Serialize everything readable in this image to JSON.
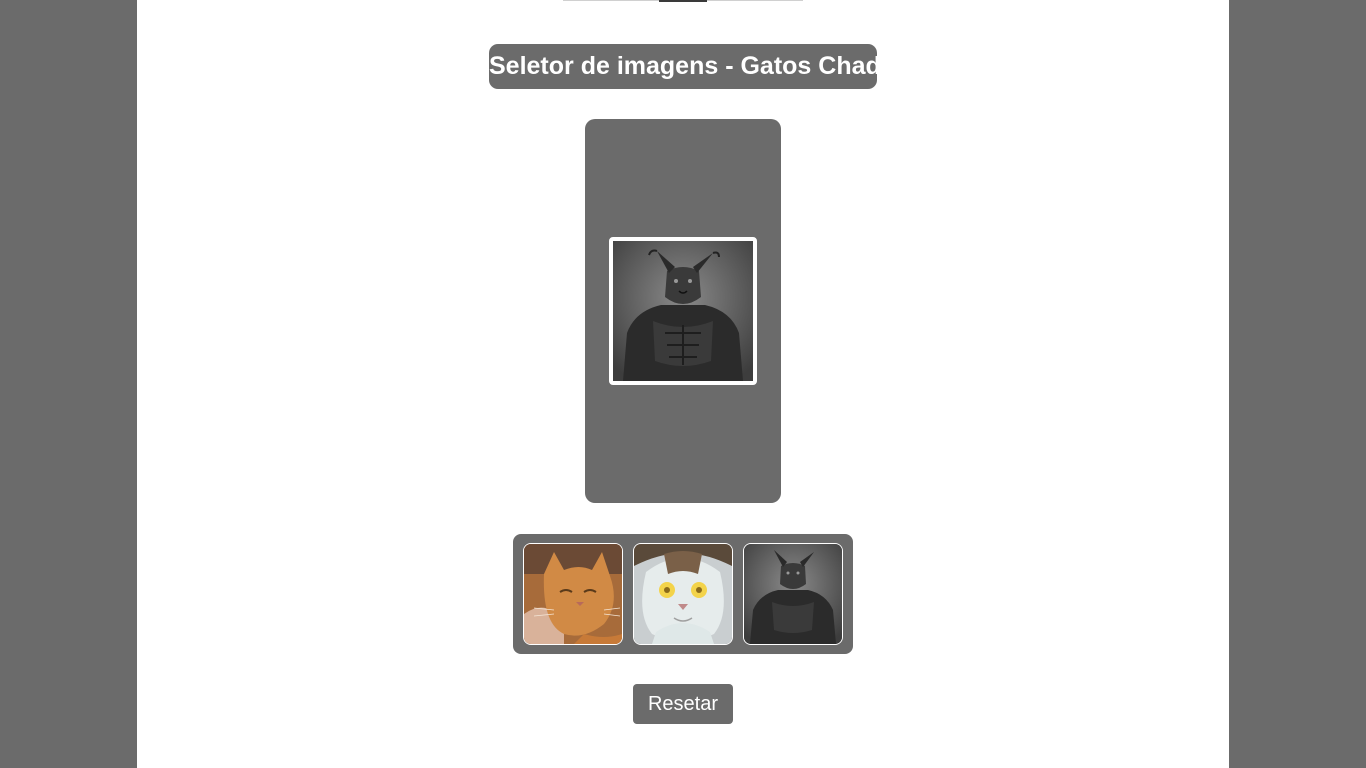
{
  "header": {
    "title": "Seletor de imagens - Gatos Chad"
  },
  "viewer": {
    "selected_image": "chad-cat-dark"
  },
  "thumbnails": [
    {
      "image": "orange-tabby-cat"
    },
    {
      "image": "white-cat-glowing-eyes"
    },
    {
      "image": "chad-cat-dark"
    }
  ],
  "controls": {
    "reset_label": "Resetar"
  },
  "colors": {
    "panel": "#6b6b6b",
    "background": "#6b6b6b",
    "page": "#ffffff"
  }
}
